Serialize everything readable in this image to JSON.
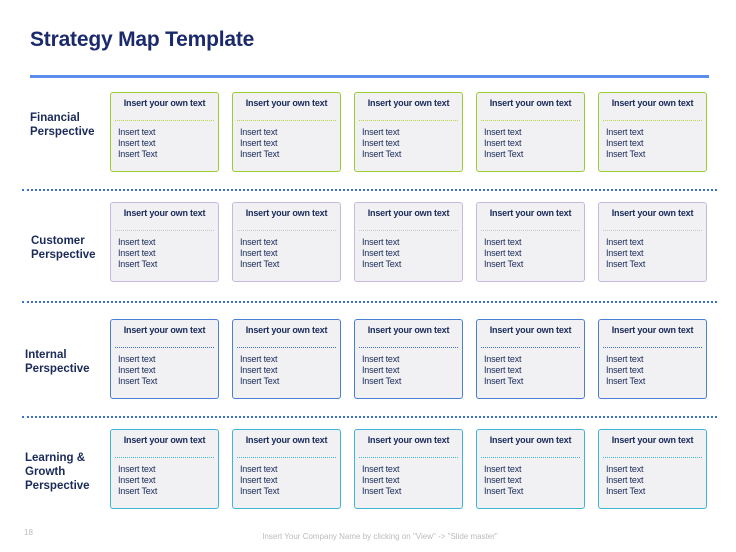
{
  "title": "Strategy Map Template",
  "rows": [
    {
      "label": "Financial Perspective",
      "label_lines": [
        "Financial",
        "Perspective"
      ],
      "border_color": "#9acd32",
      "separator_color": "#b5d84a",
      "cards": [
        {
          "title": "Insert your own text",
          "lines": [
            "Insert text",
            "Insert text",
            "Insert Text"
          ]
        },
        {
          "title": "Insert your own text",
          "lines": [
            "Insert text",
            "Insert text",
            "Insert Text"
          ]
        },
        {
          "title": "Insert your own text",
          "lines": [
            "Insert text",
            "Insert text",
            "Insert Text"
          ]
        },
        {
          "title": "Insert your own text",
          "lines": [
            "Insert text",
            "Insert text",
            "Insert Text"
          ]
        },
        {
          "title": "Insert your own text",
          "lines": [
            "Insert text",
            "Insert text",
            "Insert Text"
          ]
        }
      ]
    },
    {
      "label": "Customer Perspective",
      "label_lines": [
        "Customer",
        "Perspective"
      ],
      "border_color": "#c9b8de",
      "separator_color": "#c8c8d0",
      "cards": [
        {
          "title": "Insert your own text",
          "lines": [
            "Insert text",
            "Insert text",
            "Insert Text"
          ]
        },
        {
          "title": "Insert your own text",
          "lines": [
            "Insert text",
            "Insert text",
            "Insert Text"
          ]
        },
        {
          "title": "Insert your own text",
          "lines": [
            "Insert text",
            "Insert text",
            "Insert Text"
          ]
        },
        {
          "title": "Insert your own text",
          "lines": [
            "Insert text",
            "Insert text",
            "Insert Text"
          ]
        },
        {
          "title": "Insert your own text",
          "lines": [
            "Insert text",
            "Insert text",
            "Insert Text"
          ]
        }
      ]
    },
    {
      "label": "Internal Perspective",
      "label_lines": [
        "Internal",
        "Perspective"
      ],
      "border_color": "#4a7fd6",
      "separator_color": "#3b6fd4",
      "cards": [
        {
          "title": "Insert your own text",
          "lines": [
            "Insert text",
            "Insert text",
            "Insert Text"
          ]
        },
        {
          "title": "Insert your own text",
          "lines": [
            "Insert text",
            "Insert text",
            "Insert Text"
          ]
        },
        {
          "title": "Insert your own text",
          "lines": [
            "Insert text",
            "Insert text",
            "Insert Text"
          ]
        },
        {
          "title": "Insert your own text",
          "lines": [
            "Insert text",
            "Insert text",
            "Insert Text"
          ]
        },
        {
          "title": "Insert your own text",
          "lines": [
            "Insert text",
            "Insert text",
            "Insert Text"
          ]
        }
      ]
    },
    {
      "label": "Learning & Growth Perspective",
      "label_lines": [
        "Learning &",
        "Growth",
        "Perspective"
      ],
      "border_color": "#3fb6d8",
      "separator_color": "#3fb6d8",
      "cards": [
        {
          "title": "Insert your own text",
          "lines": [
            "Insert text",
            "Insert text",
            "Insert Text"
          ]
        },
        {
          "title": "Insert your own text",
          "lines": [
            "Insert text",
            "Insert text",
            "Insert Text"
          ]
        },
        {
          "title": "Insert your own text",
          "lines": [
            "Insert text",
            "Insert text",
            "Insert Text"
          ]
        },
        {
          "title": "Insert your own text",
          "lines": [
            "Insert text",
            "Insert text",
            "Insert Text"
          ]
        },
        {
          "title": "Insert your own text",
          "lines": [
            "Insert text",
            "Insert text",
            "Insert Text"
          ]
        }
      ]
    }
  ],
  "colors": {
    "title": "#1a2a6c",
    "title_rule": "#5b8def",
    "divider": "#3b6fd4",
    "card_fill": "#f1f1f3"
  },
  "footer": {
    "page_number": "18",
    "text": "Insert Your Company Name by clicking on \"View\" -> \"Slide master\""
  }
}
